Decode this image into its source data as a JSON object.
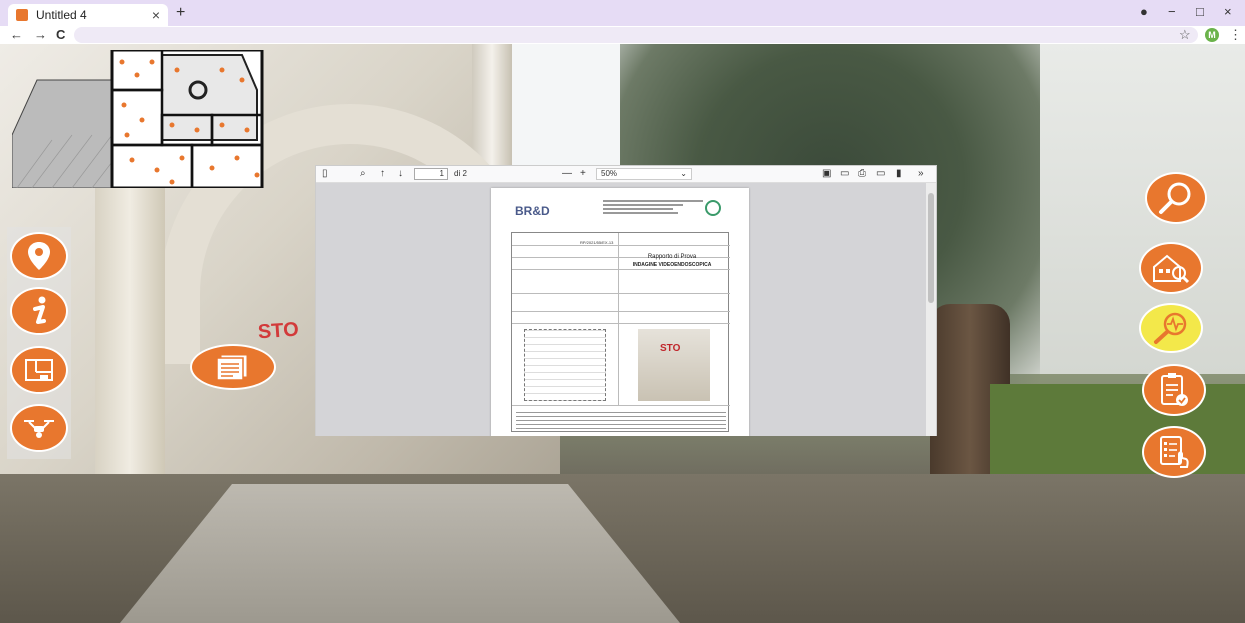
{
  "browser": {
    "tab_title": "Untitled 4",
    "tab_close": "×",
    "new_tab": "+",
    "window_controls": [
      "−",
      "□",
      "×"
    ],
    "nav": {
      "back": "←",
      "forward": "→",
      "reload": "C"
    },
    "star": "☆",
    "avatar_letter": "M",
    "menu": "⋮"
  },
  "pdf_viewer": {
    "page_number": "1",
    "page_of": "di 2",
    "zoom": "50%",
    "zoom_out": "—",
    "zoom_in": "+",
    "more": "»",
    "document": {
      "logo": "BR&D",
      "doc_number": "RP/2021/55/EX-13",
      "report_title": "Rapporto di Prova",
      "report_subtitle": "INDAGINE VIDEOENDOSCOPICA",
      "photo_text": "STO"
    }
  },
  "scene": {
    "graffiti": "STO"
  },
  "colors": {
    "accent": "#e8772e",
    "highlight": "#f3e84a",
    "tab_bar": "#e6dcf5"
  },
  "icons": {
    "left_tools": [
      "location-pin-icon",
      "info-icon",
      "floor-plan-icon",
      "drone-icon"
    ],
    "right_tools": [
      "magnifier-icon",
      "house-inspection-icon",
      "diagnostic-scan-icon",
      "clipboard-check-icon",
      "checklist-touch-icon"
    ],
    "documents": "documents-icon"
  }
}
